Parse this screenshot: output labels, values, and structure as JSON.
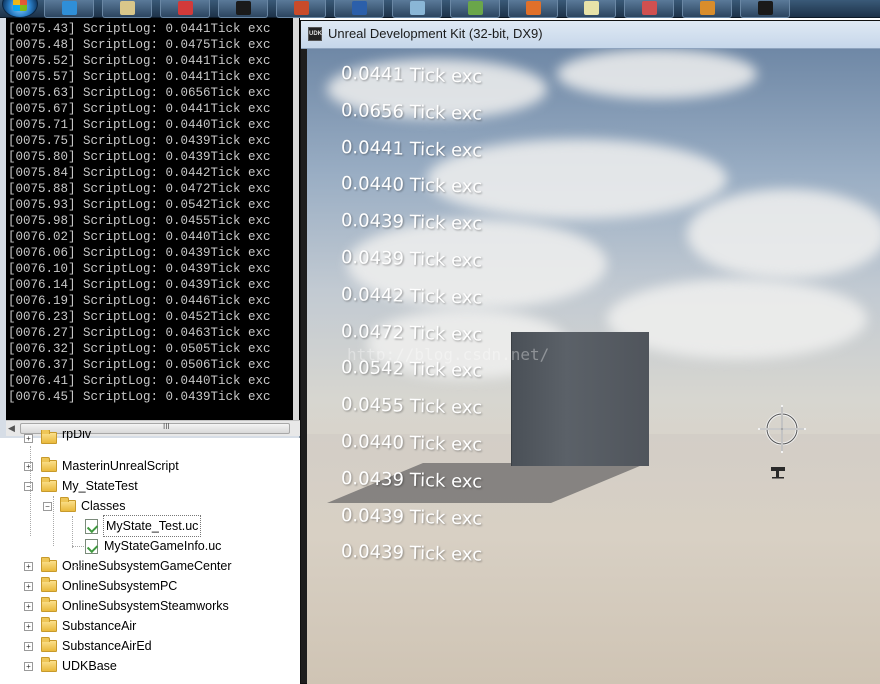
{
  "taskbar": {
    "buttons": [
      {
        "icon": "ie-icon",
        "color": "#2f8fd8"
      },
      {
        "icon": "explorer-icon",
        "color": "#d9c78a"
      },
      {
        "icon": "red-app-icon",
        "color": "#d23a3a"
      },
      {
        "icon": "udk-icon",
        "color": "#1a1a1a"
      },
      {
        "icon": "red-chart-icon",
        "color": "#c94b2a"
      },
      {
        "icon": "word-icon",
        "color": "#2b5faa"
      },
      {
        "icon": "tool-icon",
        "color": "#8ab6d6"
      },
      {
        "icon": "book-icon",
        "color": "#6aa64a"
      },
      {
        "icon": "firefox-icon",
        "color": "#e0702a"
      },
      {
        "icon": "note-icon",
        "color": "#e7e2a8"
      },
      {
        "icon": "paint-icon",
        "color": "#d05050"
      },
      {
        "icon": "puzzle-icon",
        "color": "#d98d2c"
      },
      {
        "icon": "udk-icon",
        "color": "#1a1a1a"
      }
    ]
  },
  "console": {
    "lines": [
      "[0075.43] ScriptLog: 0.0441Tick exc",
      "[0075.48] ScriptLog: 0.0475Tick exc",
      "[0075.52] ScriptLog: 0.0441Tick exc",
      "[0075.57] ScriptLog: 0.0441Tick exc",
      "[0075.63] ScriptLog: 0.0656Tick exc",
      "[0075.67] ScriptLog: 0.0441Tick exc",
      "[0075.71] ScriptLog: 0.0440Tick exc",
      "[0075.75] ScriptLog: 0.0439Tick exc",
      "[0075.80] ScriptLog: 0.0439Tick exc",
      "[0075.84] ScriptLog: 0.0442Tick exc",
      "[0075.88] ScriptLog: 0.0472Tick exc",
      "[0075.93] ScriptLog: 0.0542Tick exc",
      "[0075.98] ScriptLog: 0.0455Tick exc",
      "[0076.02] ScriptLog: 0.0440Tick exc",
      "[0076.06] ScriptLog: 0.0439Tick exc",
      "[0076.10] ScriptLog: 0.0439Tick exc",
      "[0076.14] ScriptLog: 0.0439Tick exc",
      "[0076.19] ScriptLog: 0.0446Tick exc",
      "[0076.23] ScriptLog: 0.0452Tick exc",
      "[0076.27] ScriptLog: 0.0463Tick exc",
      "[0076.32] ScriptLog: 0.0505Tick exc",
      "[0076.37] ScriptLog: 0.0506Tick exc",
      "[0076.41] ScriptLog: 0.0440Tick exc",
      "[0076.45] ScriptLog: 0.0439Tick exc"
    ],
    "scroll_grip": "III"
  },
  "tree": {
    "top_partial": "rpDiv",
    "items": [
      {
        "label": "MasterinUnrealScript",
        "type": "folder",
        "expander": "+"
      },
      {
        "label": "My_StateTest",
        "type": "folder-open",
        "expander": "−"
      },
      {
        "label": "Classes",
        "type": "folder-open",
        "expander": "−"
      },
      {
        "label": "MyState_Test.uc",
        "type": "file",
        "selected": true
      },
      {
        "label": "MyStateGameInfo.uc",
        "type": "file"
      },
      {
        "label": "OnlineSubsystemGameCenter",
        "type": "folder",
        "expander": "+"
      },
      {
        "label": "OnlineSubsystemPC",
        "type": "folder",
        "expander": "+"
      },
      {
        "label": "OnlineSubsystemSteamworks",
        "type": "folder",
        "expander": "+"
      },
      {
        "label": "SubstanceAir",
        "type": "folder",
        "expander": "+"
      },
      {
        "label": "SubstanceAirEd",
        "type": "folder",
        "expander": "+"
      },
      {
        "label": "UDKBase",
        "type": "folder",
        "expander": "+"
      }
    ]
  },
  "udk_window": {
    "title": "Unreal Development Kit (32-bit, DX9)",
    "app_icon_text": "UDK",
    "watermark": "http://blog.csdn.net/",
    "hud_lines": [
      "0.0441 Tick exc",
      "0.0656 Tick exc",
      "0.0441 Tick exc",
      "0.0440 Tick exc",
      "0.0439 Tick exc",
      "0.0439 Tick exc",
      "0.0442 Tick exc",
      "0.0472 Tick exc",
      "0.0542 Tick exc",
      "0.0455 Tick exc",
      "0.0440 Tick exc",
      "0.0439 Tick exc",
      "0.0439 Tick exc",
      "0.0439 Tick exc"
    ]
  }
}
